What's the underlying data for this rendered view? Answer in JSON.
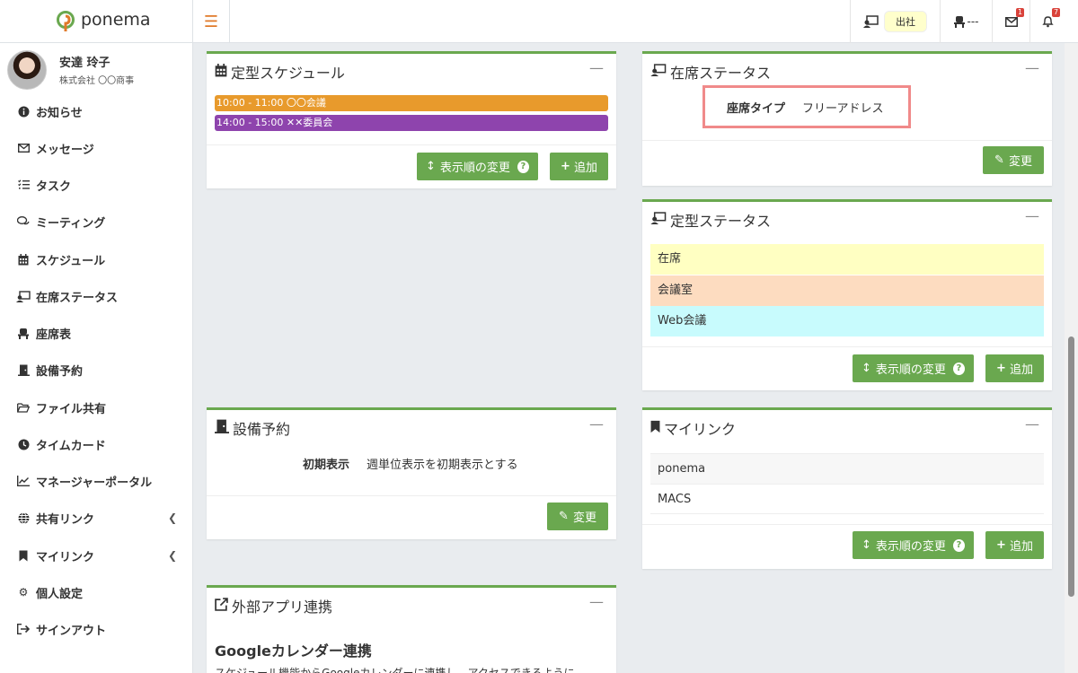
{
  "header": {
    "app_name": "ponema",
    "presence_label": "出社",
    "seat_label": "---",
    "mail_count": "1",
    "notification_count": "7"
  },
  "user": {
    "name": "安達 玲子",
    "org": "株式会社 〇〇商事"
  },
  "sidebar": {
    "items": [
      {
        "label": "お知らせ",
        "icon": "info-icon"
      },
      {
        "label": "メッセージ",
        "icon": "envelope-icon"
      },
      {
        "label": "タスク",
        "icon": "task-list-icon"
      },
      {
        "label": "ミーティング",
        "icon": "chat-icon"
      },
      {
        "label": "スケジュール",
        "icon": "calendar-icon"
      },
      {
        "label": "在席ステータス",
        "icon": "presence-icon"
      },
      {
        "label": "座席表",
        "icon": "seat-icon"
      },
      {
        "label": "設備予約",
        "icon": "door-icon"
      },
      {
        "label": "ファイル共有",
        "icon": "folder-icon"
      },
      {
        "label": "タイムカード",
        "icon": "clock-icon"
      },
      {
        "label": "マネージャーポータル",
        "icon": "chart-icon"
      },
      {
        "label": "共有リンク",
        "icon": "globe-icon"
      },
      {
        "label": "マイリンク",
        "icon": "bookmark-icon"
      },
      {
        "label": "個人設定",
        "icon": "gear-icon"
      },
      {
        "label": "サインアウト",
        "icon": "signout-icon"
      }
    ]
  },
  "routine_schedule": {
    "title": "定型スケジュール",
    "items": [
      {
        "text": "10:00 - 11:00 〇〇会議",
        "color": "#e89a2c"
      },
      {
        "text": "14:00 - 15:00 ✕✕委員会",
        "color": "#8e44ad"
      }
    ],
    "reorder_label": "表示順の変更",
    "add_label": "追加"
  },
  "presence_status": {
    "title": "在席ステータス",
    "seat_type_label": "座席タイプ",
    "seat_type_value": "フリーアドレス",
    "change_label": "変更"
  },
  "routine_status": {
    "title": "定型ステータス",
    "items": [
      {
        "label": "在席",
        "color": "#ffffc2"
      },
      {
        "label": "会議室",
        "color": "#fddcc0"
      },
      {
        "label": "Web会議",
        "color": "#c8fbfd"
      }
    ],
    "reorder_label": "表示順の変更",
    "add_label": "追加"
  },
  "facility_booking": {
    "title": "設備予約",
    "initial_label": "初期表示",
    "initial_value": "週単位表示を初期表示とする",
    "change_label": "変更"
  },
  "my_links": {
    "title": "マイリンク",
    "items": [
      "ponema",
      "MACS"
    ],
    "reorder_label": "表示順の変更",
    "add_label": "追加"
  },
  "external_apps": {
    "title": "外部アプリ連携",
    "section_title": "Googleカレンダー連携",
    "description": "スケジュール機能からGoogleカレンダーに連携し、アクセスできるように"
  }
}
